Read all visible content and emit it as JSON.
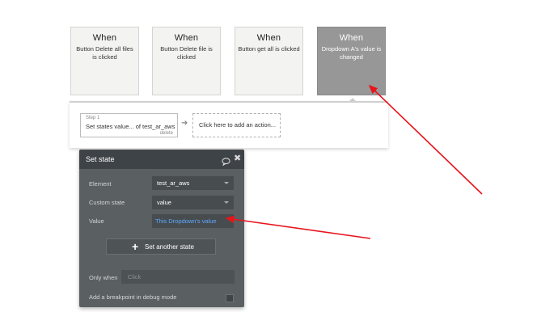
{
  "events": [
    {
      "when": "When",
      "description": "Button Delete all files is clicked",
      "selected": false
    },
    {
      "when": "When",
      "description": "Button Delete file is clicked",
      "selected": false
    },
    {
      "when": "When",
      "description": "Button get all is clicked",
      "selected": false
    },
    {
      "when": "When",
      "description": "Dropdown A's value is changed",
      "selected": true
    }
  ],
  "workflow": {
    "step": {
      "number": "Step 1",
      "name": "Set states value... of test_ar_aws",
      "delete": "delete"
    },
    "add_action": "Click here to add an action..."
  },
  "panel": {
    "title": "Set state",
    "element_label": "Element",
    "element_value": "test_ar_aws",
    "custom_state_label": "Custom state",
    "custom_state_value": "value",
    "value_label": "Value",
    "value_value": "This Dropdown's value",
    "set_another_label": "Set another state",
    "only_when_label": "Only when",
    "only_when_placeholder": "Click",
    "breakpoint_label": "Add a breakpoint in debug mode"
  },
  "colors": {
    "annotation_arrow": "#e8141b",
    "panel_bg": "#5a5f62",
    "panel_header": "#3e4347",
    "selected_event": "#979797",
    "expression_text": "#5ea7ff"
  },
  "icons": [
    "comment-icon",
    "close-icon",
    "arrow-right-icon",
    "plus-icon",
    "caret-down-icon"
  ]
}
